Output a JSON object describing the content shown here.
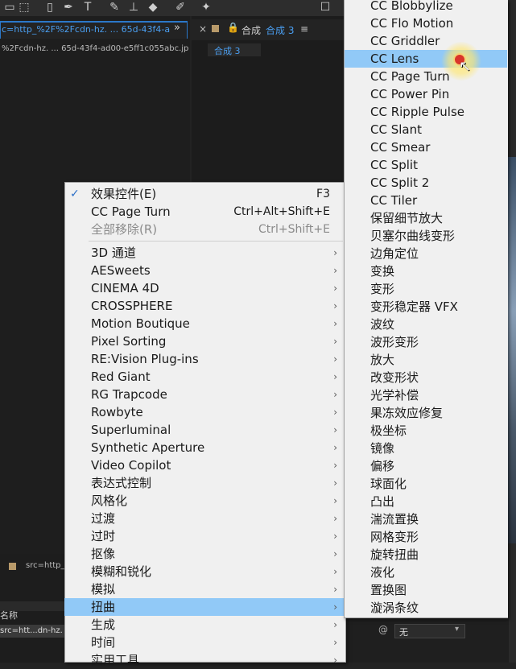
{
  "project_panel": {
    "tab_label": "c=http_%2F%2Fcdn-hz. ... 65d-43f4-a",
    "path_text": "%2Fcdn-hz. ... 65d-43f4-ad00-e5ff1c055abc.jp",
    "chevrons": "»"
  },
  "comp_panel": {
    "close": "×",
    "lock": "🔒",
    "label": "合成",
    "comp_name": "合成 3",
    "menu": "≡",
    "sub_tab": "合成 3"
  },
  "timeline": {
    "src_label": "src=http_",
    "name_header": "名称",
    "src_row": "src=htt...dn-hz."
  },
  "right_strip": {
    "dropdown_value": "无",
    "icon": "@",
    "arrow": "▾"
  },
  "context_menu": {
    "check_mark": "✓",
    "top_items": [
      {
        "label": "效果控件(E)",
        "shortcut": "F3",
        "checked": true,
        "disabled": false
      },
      {
        "label": "CC Page Turn",
        "shortcut": "Ctrl+Alt+Shift+E",
        "checked": false,
        "disabled": false
      },
      {
        "label": "全部移除(R)",
        "shortcut": "Ctrl+Shift+E",
        "checked": false,
        "disabled": true
      }
    ],
    "items": [
      "3D 通道",
      "AESweets",
      "CINEMA 4D",
      "CROSSPHERE",
      "Motion Boutique",
      "Pixel Sorting",
      "RE:Vision Plug-ins",
      "Red Giant",
      "RG Trapcode",
      "Rowbyte",
      "Superluminal",
      "Synthetic Aperture",
      "Video Copilot",
      "表达式控制",
      "风格化",
      "过渡",
      "过时",
      "抠像",
      "模糊和锐化",
      "模拟",
      "扭曲",
      "生成",
      "时间",
      "实用工具"
    ],
    "highlighted": "扭曲",
    "arrow": "›"
  },
  "submenu": {
    "items": [
      "CC Blobbylize",
      "CC Flo Motion",
      "CC Griddler",
      "CC Lens",
      "CC Page Turn",
      "CC Power Pin",
      "CC Ripple Pulse",
      "CC Slant",
      "CC Smear",
      "CC Split",
      "CC Split 2",
      "CC Tiler",
      "保留细节放大",
      "贝塞尔曲线变形",
      "边角定位",
      "变换",
      "变形",
      "变形稳定器 VFX",
      "波纹",
      "波形变形",
      "放大",
      "改变形状",
      "光学补偿",
      "果冻效应修复",
      "极坐标",
      "镜像",
      "偏移",
      "球面化",
      "凸出",
      "湍流置换",
      "网格变形",
      "旋转扭曲",
      "液化",
      "置换图",
      "漩涡条纹"
    ],
    "highlighted": "CC Lens"
  },
  "cursor": {
    "arrow": "↖"
  }
}
